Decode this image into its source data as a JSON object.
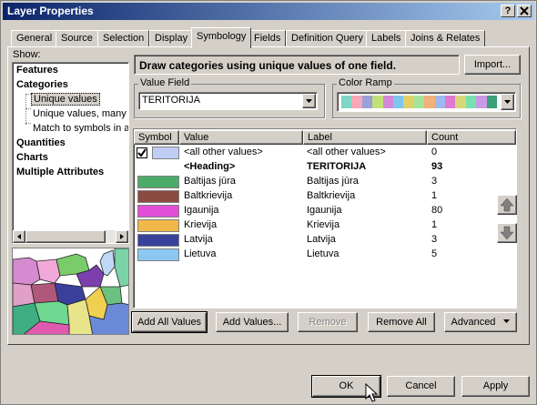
{
  "window": {
    "title": "Layer Properties",
    "help_label": "?",
    "close_label": "X"
  },
  "tabs": [
    {
      "label": "General"
    },
    {
      "label": "Source"
    },
    {
      "label": "Selection"
    },
    {
      "label": "Display"
    },
    {
      "label": "Symbology"
    },
    {
      "label": "Fields"
    },
    {
      "label": "Definition Query"
    },
    {
      "label": "Labels"
    },
    {
      "label": "Joins & Relates"
    }
  ],
  "show": {
    "label": "Show:",
    "items": [
      {
        "label": "Features"
      },
      {
        "label": "Categories"
      },
      {
        "label": "Unique values"
      },
      {
        "label": "Unique values, many f"
      },
      {
        "label": "Match to symbols in a"
      },
      {
        "label": "Quantities"
      },
      {
        "label": "Charts"
      },
      {
        "label": "Multiple Attributes"
      }
    ]
  },
  "header": {
    "description": "Draw categories using unique values of one field.",
    "import_label": "Import..."
  },
  "value_field": {
    "legend": "Value Field",
    "value": "TERITORIJA"
  },
  "color_ramp": {
    "legend": "Color Ramp",
    "colors": [
      "#7fd6c4",
      "#f7a7b6",
      "#9aa0d8",
      "#c2e07a",
      "#d28ad8",
      "#7fc6ee",
      "#e0d06a",
      "#a4e49a",
      "#f2b07a",
      "#9fb8f0",
      "#e07ad0",
      "#d8d87a",
      "#7ae0b0",
      "#c99ae8",
      "#3aa07a"
    ]
  },
  "table": {
    "headers": {
      "symbol": "Symbol",
      "value": "Value",
      "label": "Label",
      "count": "Count"
    },
    "rows": [
      {
        "checked": true,
        "color": "#c0cdf5",
        "value": "<all other values>",
        "label": "<all other values>",
        "count": "0",
        "bold": false
      },
      {
        "checked": false,
        "color": null,
        "value": "<Heading>",
        "label": "TERITORIJA",
        "count": "93",
        "bold": true
      },
      {
        "checked": false,
        "color": "#4cab6a",
        "value": "Baltijas jūra",
        "label": "Baltijas jūra",
        "count": "3",
        "bold": false
      },
      {
        "checked": false,
        "color": "#8b4a42",
        "value": "Baltkrievija",
        "label": "Baltkrievija",
        "count": "1",
        "bold": false
      },
      {
        "checked": false,
        "color": "#e24ed6",
        "value": "Igaunija",
        "label": "Igaunija",
        "count": "80",
        "bold": false
      },
      {
        "checked": false,
        "color": "#f0b84a",
        "value": "Krievija",
        "label": "Krievija",
        "count": "1",
        "bold": false
      },
      {
        "checked": false,
        "color": "#38419c",
        "value": "Latvija",
        "label": "Latvija",
        "count": "3",
        "bold": false
      },
      {
        "checked": false,
        "color": "#8cc7f2",
        "value": "Lietuva",
        "label": "Lietuva",
        "count": "5",
        "bold": false
      }
    ]
  },
  "actions": {
    "add_all": "Add All Values",
    "add": "Add Values...",
    "remove": "Remove",
    "remove_all": "Remove All",
    "advanced": "Advanced"
  },
  "footer": {
    "ok": "OK",
    "cancel": "Cancel",
    "apply": "Apply"
  }
}
